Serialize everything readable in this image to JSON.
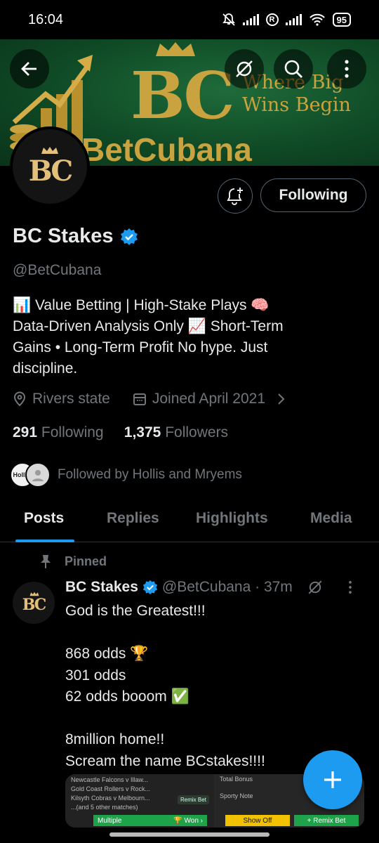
{
  "status": {
    "time": "16:04",
    "battery": "95",
    "r_badge": "R"
  },
  "banner": {
    "monogram": "BC",
    "tagline_line1": "Where Big",
    "tagline_line2": "Wins Begin",
    "brand": "BetCubana"
  },
  "profile": {
    "avatar_monogram": "BC",
    "follow_button": "Following",
    "name": "BC Stakes",
    "handle": "@BetCubana",
    "bio": [
      "📊 Value Betting | High-Stake Plays  🧠",
      "Data-Driven Analysis Only  📈 Short-Term",
      "Gains • Long-Term Profit   No hype. Just",
      "discipline."
    ],
    "location": "Rivers state",
    "joined": "Joined April 2021",
    "following_count": "291",
    "following_label": "Following",
    "followers_count": "1,375",
    "followers_label": "Followers",
    "followed_by": "Followed by Hollis and Mryems",
    "follower_avatar_1": "Hollis."
  },
  "tabs": [
    {
      "label": "Posts"
    },
    {
      "label": "Replies"
    },
    {
      "label": "Highlights"
    },
    {
      "label": "Media"
    }
  ],
  "post": {
    "pinned_label": "Pinned",
    "avatar_monogram": "BC",
    "author": "BC Stakes",
    "meta": "@BetCubana · 37m",
    "lines": [
      "God is the Greatest!!!",
      "",
      "868 odds 🏆",
      "301 odds",
      "62 odds booom ✅",
      "",
      "8million home!!",
      "Scream the name BCstakes!!!!"
    ],
    "media": {
      "matches": [
        "Newcastle Falcons v Illaw...",
        "Gold Coast Rollers v Rock...",
        "Kilsyth Cobras v Melbourn...",
        "...(and 5 other matches)"
      ],
      "remix_small": "Remix Bet",
      "multiple": "Multiple",
      "won": "🏆 Won ›",
      "total_bonus": "Total Bonus",
      "sporty_note": "Sporty Note",
      "show_off": "Show Off",
      "remix_big": "+ Remix Bet"
    }
  },
  "colors": {
    "accent": "#1d9bf0",
    "gold": "#c9a33f",
    "banner_green": "#0f4a26"
  },
  "icons": [
    "back-arrow-icon",
    "grok-icon",
    "search-icon",
    "more-vertical-icon",
    "bell-plus-icon",
    "verified-badge-icon",
    "location-pin-icon",
    "calendar-icon",
    "chevron-right-icon",
    "pin-icon",
    "plus-icon"
  ]
}
